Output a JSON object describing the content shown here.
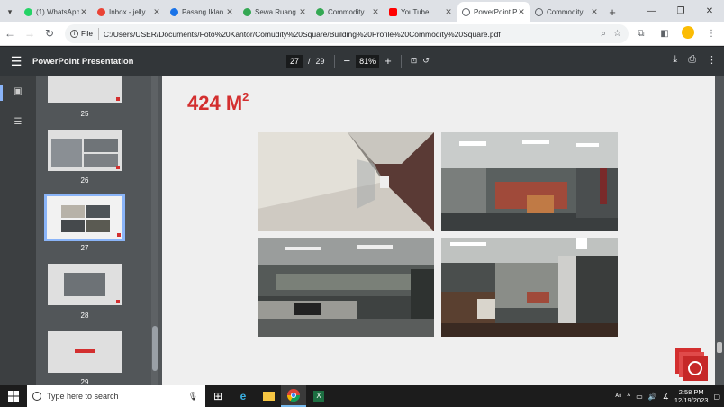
{
  "tabs": [
    {
      "label": "(1) WhatsApp",
      "color": "#25d366",
      "glyph": "✆"
    },
    {
      "label": "Inbox - jelly",
      "color": "#ea4335",
      "glyph": "M"
    },
    {
      "label": "Pasang Iklan",
      "color": "#1a73e8",
      "glyph": "●"
    },
    {
      "label": "Sewa Ruang",
      "color": "#34a853",
      "glyph": "●"
    },
    {
      "label": "Commodity",
      "color": "#34a853",
      "glyph": "●"
    },
    {
      "label": "YouTube",
      "color": "#ff0000",
      "glyph": "▶"
    },
    {
      "label": "PowerPoint Pre",
      "color": "#5f6368",
      "glyph": "◎"
    },
    {
      "label": "Commodity",
      "color": "#5f6368",
      "glyph": "◎"
    }
  ],
  "address": {
    "chip": "File",
    "url": "C:/Users/USER/Documents/Foto%20Kantor/Comudity%20Square/Building%20Profile%20Commodity%20Square.pdf"
  },
  "pdf": {
    "title": "PowerPoint Presentation",
    "current_page": "27",
    "page_sep": "/",
    "total_pages": "29",
    "zoom": "81%"
  },
  "thumbnails": [
    {
      "num": "25"
    },
    {
      "num": "26"
    },
    {
      "num": "27"
    },
    {
      "num": "28"
    },
    {
      "num": "29"
    }
  ],
  "slide": {
    "heading": "424 M",
    "heading_sup": "2"
  },
  "taskbar": {
    "search_placeholder": "Type here to search",
    "time": "2:58 PM",
    "date": "12/19/2023"
  },
  "colors": {
    "accent_red": "#d32f2f",
    "pdf_toolbar": "#323639",
    "highlight": "#8ab4f8"
  }
}
